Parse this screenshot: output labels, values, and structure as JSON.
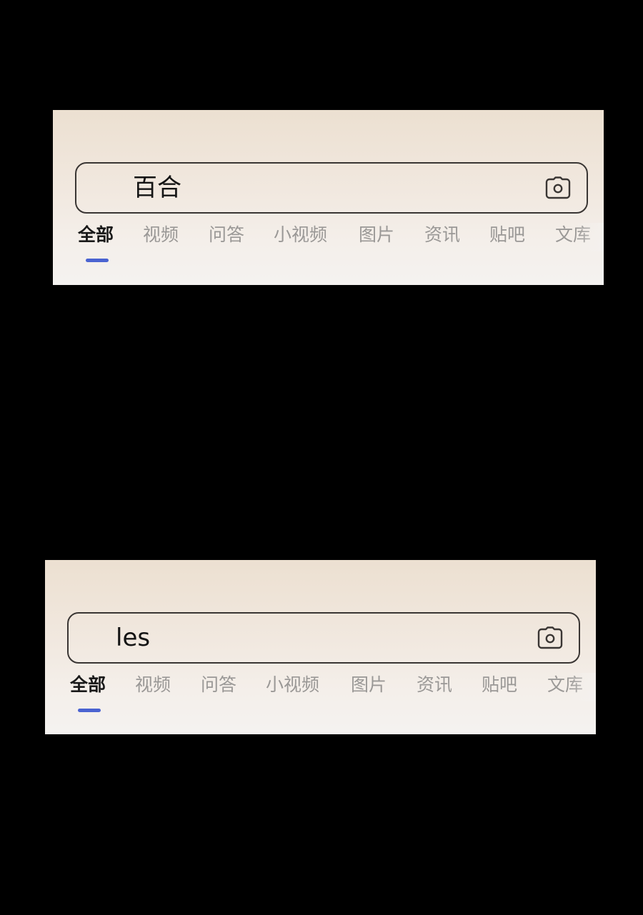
{
  "panels": [
    {
      "search": {
        "query": "百合"
      },
      "tabs": {
        "items": [
          "全部",
          "视频",
          "问答",
          "小视频",
          "图片",
          "资讯",
          "贴吧",
          "文库"
        ],
        "active_index": 0
      },
      "camera_icon": "camera-icon"
    },
    {
      "search": {
        "query": "les"
      },
      "tabs": {
        "items": [
          "全部",
          "视频",
          "问答",
          "小视频",
          "图片",
          "资讯",
          "贴吧",
          "文库"
        ],
        "active_index": 0
      },
      "camera_icon": "camera-icon"
    }
  ],
  "colors": {
    "background": "#000000",
    "active_indicator": "#4a63d1",
    "active_tab_text": "#1a1a1a",
    "inactive_tab_text": "#9a9896",
    "search_border": "#3a3634"
  }
}
